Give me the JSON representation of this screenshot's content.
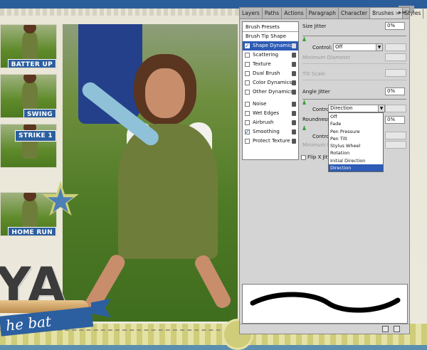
{
  "scrapbook": {
    "thumb_labels": [
      "BATTER UP",
      "SWING",
      "STRIKE 1",
      "HOME RUN"
    ],
    "big_text": "YA",
    "ribbon_text": "he bat"
  },
  "panel": {
    "tabs": [
      "Layers",
      "Paths",
      "Actions",
      "Paragraph",
      "Character",
      "Brushes",
      "Styles"
    ],
    "active_tab_close": "×",
    "menu_glyph": "▸≡",
    "left_list": {
      "head": "Brush Presets",
      "items": [
        {
          "label": "Brush Tip Shape",
          "checkbox": false,
          "checked": false,
          "lock": false
        },
        {
          "label": "Shape Dynamics",
          "checkbox": true,
          "checked": true,
          "lock": true,
          "selected": true
        },
        {
          "label": "Scattering",
          "checkbox": true,
          "checked": false,
          "lock": true
        },
        {
          "label": "Texture",
          "checkbox": true,
          "checked": false,
          "lock": true
        },
        {
          "label": "Dual Brush",
          "checkbox": true,
          "checked": false,
          "lock": true
        },
        {
          "label": "Color Dynamics",
          "checkbox": true,
          "checked": false,
          "lock": true
        },
        {
          "label": "Other Dynamics",
          "checkbox": true,
          "checked": false,
          "lock": true
        },
        {
          "label": "Noise",
          "checkbox": true,
          "checked": false,
          "lock": true
        },
        {
          "label": "Wet Edges",
          "checkbox": true,
          "checked": false,
          "lock": true
        },
        {
          "label": "Airbrush",
          "checkbox": true,
          "checked": false,
          "lock": true
        },
        {
          "label": "Smoothing",
          "checkbox": true,
          "checked": true,
          "lock": true
        },
        {
          "label": "Protect Texture",
          "checkbox": true,
          "checked": false,
          "lock": true
        }
      ]
    },
    "settings": {
      "size_jitter_label": "Size Jitter",
      "size_jitter_value": "0%",
      "control_label": "Control:",
      "control1_value": "Off",
      "min_diameter_label": "Minimum Diameter",
      "tilt_scale_label": "Tilt Scale",
      "angle_jitter_label": "Angle Jitter",
      "angle_jitter_value": "0%",
      "control2_value": "Direction",
      "roundness_label": "Roundness",
      "roundness_value": "0%",
      "control3_label": "Contro",
      "min_roundness_label": "Minimum Ro",
      "flip_label": "Flip X Jitte"
    },
    "dropdown_options": [
      "Off",
      "Fade",
      "Pen Pressure",
      "Pen Tilt",
      "Stylus Wheel",
      "Rotation",
      "Initial Direction",
      "Direction"
    ],
    "dropdown_selected": "Direction"
  }
}
